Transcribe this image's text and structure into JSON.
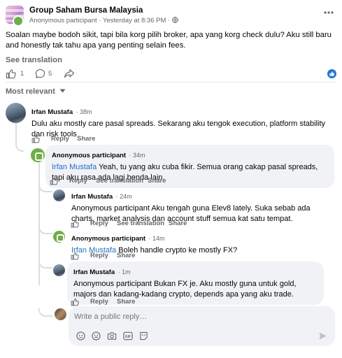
{
  "post": {
    "group_name": "Group Saham Bursa Malaysia",
    "author_meta": "Anonymous participant · Yesterday at 8:36 PM ·",
    "text": "Soalan maybe bodoh sikit, tapi bila korg pilih broker, apa yang korg check dulu? Aku still baru and honestly tak tahu apa yang penting selain fees.",
    "see_translation": "See translation",
    "likes": "1",
    "comments_count": "5",
    "sort_label": "Most relevant"
  },
  "comments": [
    {
      "author": "Irfan Mustafa",
      "time": "38m",
      "text": "Dulu aku mostly care pasal spreads. Sekarang aku tengok execution, platform stability dan risk tools",
      "reply": "Reply",
      "share": "Share"
    },
    {
      "author": "Anonymous participant",
      "time": "34m",
      "mention": "Irfan Mustafa",
      "text": " Yeah, tu yang aku cuba fikir. Semua orang cakap pasal spreads, tapi aku rasa ada lagi benda lain.",
      "reply": "Reply",
      "see_translation": "See translation",
      "share": "Share"
    },
    {
      "author": "Irfan Mustafa",
      "time": "24m",
      "text": "Anonymous participant Aku tengah guna Elev8 lately. Suka sebab ada charts, market analysis dan account stuff semua kat satu tempat.",
      "reply": "Reply",
      "see_translation": "See translation",
      "share": "Share"
    },
    {
      "author": "Anonymous participant",
      "time": "14m",
      "mention": "Irfan Mustafa",
      "text": " Boleh handle crypto ke mostly FX?",
      "reply": "Reply",
      "share": "Share"
    },
    {
      "author": "Irfan Mustafa",
      "time": "1m",
      "text": "Anonymous participant Bukan FX je. Aku mostly guna untuk gold, majors dan kadang-kadang crypto, depends apa yang aku trade.",
      "reply": "Reply",
      "share": "Share"
    }
  ],
  "composer": {
    "placeholder": "Write a public reply…"
  },
  "colors": {
    "link_blue": "#216fdb",
    "anon_green": "#6cb043",
    "bubble_bg": "#f0f2f5",
    "muted": "#65676b"
  },
  "icons": [
    "more-icon",
    "globe-icon",
    "like-icon",
    "comment-icon",
    "share-icon",
    "like-reaction-icon",
    "sort-chevron-icon",
    "sticker-icon",
    "emoji-icon",
    "camera-icon",
    "gif-icon",
    "avatar-sticker-icon",
    "send-icon"
  ]
}
